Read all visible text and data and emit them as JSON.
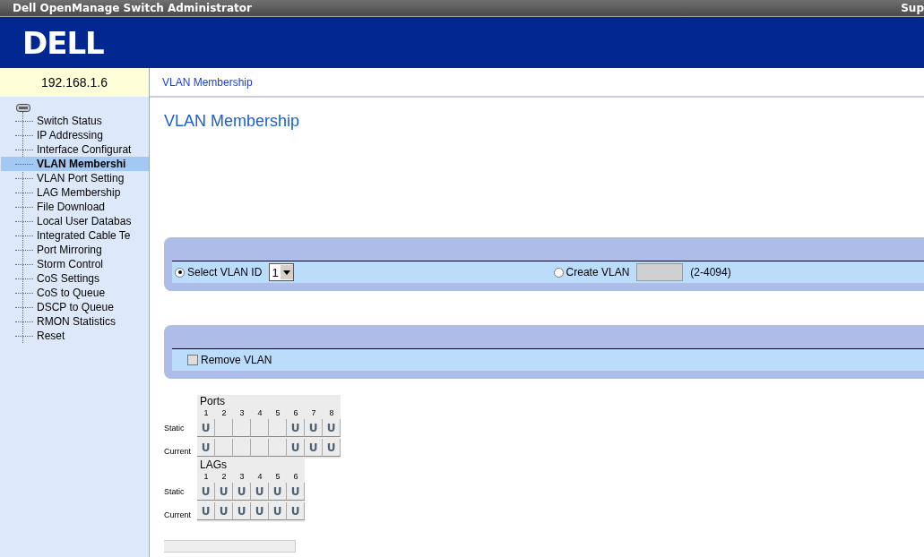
{
  "window": {
    "title": "Dell OpenManage Switch Administrator",
    "title_right": "Sup"
  },
  "banner": {
    "logo": "DELL"
  },
  "device": {
    "address": "192.168.1.6"
  },
  "breadcrumb": "VLAN Membership",
  "sidebar": {
    "items": [
      {
        "label": "Switch Status",
        "selected": false
      },
      {
        "label": "IP Addressing",
        "selected": false
      },
      {
        "label": "Interface Configurat",
        "selected": false
      },
      {
        "label": "VLAN Membershi",
        "selected": true
      },
      {
        "label": "VLAN Port Setting",
        "selected": false
      },
      {
        "label": "LAG Membership",
        "selected": false
      },
      {
        "label": "File Download",
        "selected": false
      },
      {
        "label": "Local User Databas",
        "selected": false
      },
      {
        "label": "Integrated Cable Te",
        "selected": false
      },
      {
        "label": "Port Mirroring",
        "selected": false
      },
      {
        "label": "Storm Control",
        "selected": false
      },
      {
        "label": "CoS Settings",
        "selected": false
      },
      {
        "label": "CoS to Queue",
        "selected": false
      },
      {
        "label": "DSCP to Queue",
        "selected": false
      },
      {
        "label": "RMON Statistics",
        "selected": false
      },
      {
        "label": "Reset",
        "selected": false
      }
    ]
  },
  "page_title": "VLAN Membership",
  "vlan_select": {
    "select_option": {
      "label": "Select VLAN ID",
      "selected": true
    },
    "vlan_id": "1",
    "create_option": {
      "label": "Create VLAN",
      "selected": false
    },
    "range": "(2-4094)"
  },
  "remove_vlan": {
    "label": "Remove VLAN",
    "checked": false
  },
  "grids": [
    {
      "title": "Ports",
      "row_labels": [
        "Static",
        "Current"
      ],
      "columns": [
        {
          "number": "1",
          "static": "U",
          "current": "U"
        },
        {
          "number": "2"
        },
        {
          "number": "3"
        },
        {
          "number": "4"
        },
        {
          "number": "5"
        },
        {
          "number": "6",
          "static": "U",
          "current": "U"
        },
        {
          "number": "7",
          "static": "U",
          "current": "U"
        },
        {
          "number": "8",
          "static": "U",
          "current": "U"
        }
      ]
    },
    {
      "title": "LAGs",
      "row_labels": [
        "Static",
        "Current"
      ],
      "columns": [
        {
          "number": "1",
          "static": "U",
          "current": "U"
        },
        {
          "number": "2",
          "static": "U",
          "current": "U"
        },
        {
          "number": "3",
          "static": "U",
          "current": "U"
        },
        {
          "number": "4",
          "static": "U",
          "current": "U"
        },
        {
          "number": "5",
          "static": "U",
          "current": "U"
        },
        {
          "number": "6",
          "static": "U",
          "current": "U"
        }
      ]
    }
  ]
}
